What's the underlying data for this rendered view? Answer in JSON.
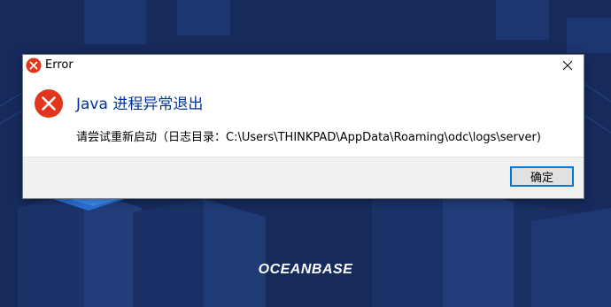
{
  "background": {
    "brand_text": "OCEANBASE",
    "color": "#162a5c"
  },
  "dialog": {
    "title": "Error",
    "main_instruction": "Java 进程异常退出",
    "content": "请尝试重新启动（日志目录：C:\\Users\\THINKPAD\\AppData\\Roaming\\odc\\logs\\server)",
    "ok_button_label": "确定",
    "icon": "error-icon",
    "close_icon": "close-icon",
    "colors": {
      "accent": "#0078d7",
      "error_red": "#e2361c",
      "instruction_blue": "#003399"
    }
  }
}
